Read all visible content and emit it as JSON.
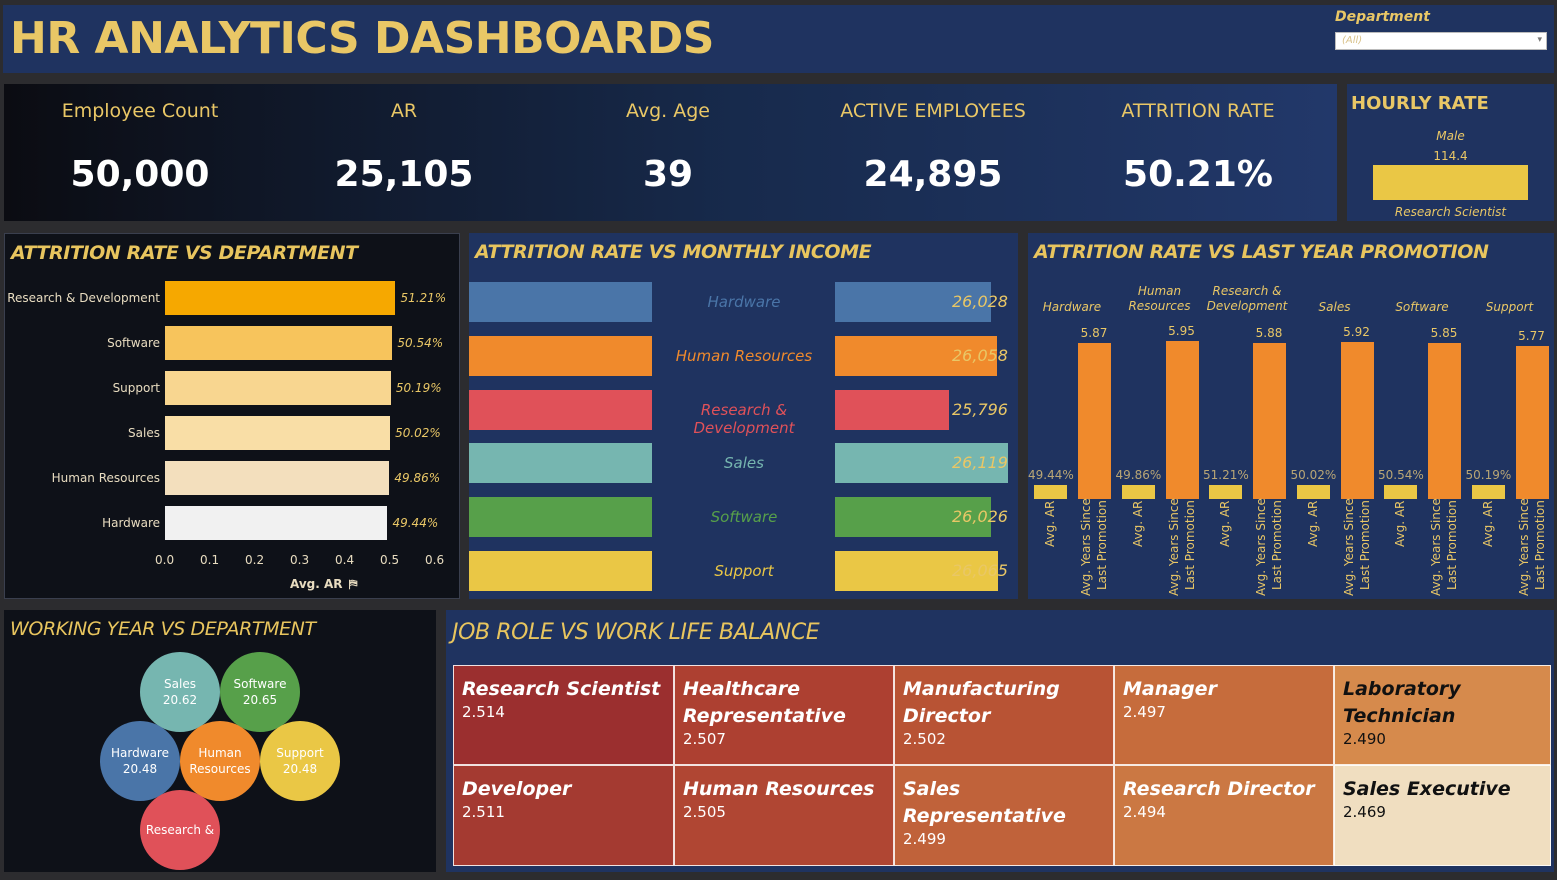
{
  "header": {
    "title": "HR ANALYTICS DASHBOARDS",
    "filter_label": "Department",
    "filter_value": "(All)"
  },
  "kpis": [
    {
      "label": "Employee Count",
      "value": "50,000"
    },
    {
      "label": "AR",
      "value": "25,105"
    },
    {
      "label": "Avg. Age",
      "value": "39"
    },
    {
      "label": "ACTIVE EMPLOYEES",
      "value": "24,895"
    },
    {
      "label": "ATTRITION RATE",
      "value": "50.21%"
    }
  ],
  "hourly_rate": {
    "title": "HOURLY RATE",
    "gender": "Male",
    "value": "114.4",
    "role": "Research Scientist"
  },
  "dept_chart": {
    "title": "ATTRITION RATE VS DEPARTMENT",
    "axis_label": "Avg. AR",
    "chart_data": {
      "type": "bar",
      "orientation": "horizontal",
      "categories": [
        "Research & Development",
        "Software",
        "Support",
        "Sales",
        "Human Resources",
        "Hardware"
      ],
      "values": [
        0.5121,
        0.5054,
        0.5019,
        0.5002,
        0.4986,
        0.4944
      ],
      "value_labels": [
        "51.21%",
        "50.54%",
        "50.19%",
        "50.02%",
        "49.86%",
        "49.44%"
      ],
      "colors": [
        "#f6a800",
        "#f7c45c",
        "#f8d690",
        "#f9dea6",
        "#f3dfbd",
        "#f1f1f1"
      ],
      "xlim": [
        0,
        0.6
      ],
      "ticks": [
        "0.0",
        "0.1",
        "0.2",
        "0.3",
        "0.4",
        "0.5",
        "0.6"
      ],
      "xlabel": "Avg. AR"
    }
  },
  "income_chart": {
    "title": "ATTRITION RATE VS MONTHLY INCOME",
    "chart_data": {
      "type": "bar",
      "categories": [
        "Hardware",
        "Human Resources",
        "Research & Development",
        "Sales",
        "Software",
        "Support"
      ],
      "attrition": [
        0.4944,
        0.4986,
        0.5121,
        0.5002,
        0.5054,
        0.5019
      ],
      "attrition_labels": [
        "49.44%",
        "49.86%",
        "51.21%",
        "50.02%",
        "50.54%",
        "50.19%"
      ],
      "income": [
        26028,
        26058,
        25796,
        26119,
        26026,
        26065
      ],
      "income_labels": [
        "26,028",
        "26,058",
        "25,796",
        "26,119",
        "26,026",
        "26,065"
      ],
      "colors": [
        "#4a75a8",
        "#f08a2c",
        "#e05159",
        "#76b6b0",
        "#57a04a",
        "#eac745"
      ]
    }
  },
  "promotion_chart": {
    "title": "ATTRITION RATE VS LAST YEAR PROMOTION",
    "chart_data": {
      "type": "bar",
      "categories": [
        "Hardware",
        "Human Resources",
        "Research & Development",
        "Sales",
        "Software",
        "Support"
      ],
      "category_labels": [
        [
          "Hardware"
        ],
        [
          "Human",
          "Resources"
        ],
        [
          "Research &",
          "Development"
        ],
        [
          "Sales"
        ],
        [
          "Software"
        ],
        [
          "Support"
        ]
      ],
      "series": [
        {
          "name": "Avg. AR",
          "values": [
            0.4944,
            0.4986,
            0.5121,
            0.5002,
            0.5054,
            0.5019
          ],
          "labels": [
            "49.44%",
            "49.86%",
            "51.21%",
            "50.02%",
            "50.54%",
            "50.19%"
          ]
        },
        {
          "name": "Avg. Years Since Last Promotion",
          "values": [
            5.87,
            5.95,
            5.88,
            5.92,
            5.85,
            5.77
          ],
          "labels": [
            "5.87",
            "5.95",
            "5.88",
            "5.92",
            "5.85",
            "5.77"
          ]
        }
      ],
      "axis_label_1": "Avg. AR",
      "axis_label_2a": "Avg. Years Since",
      "axis_label_2b": "Last Promotion"
    }
  },
  "working_year": {
    "title": "WORKING YEAR VS DEPARTMENT",
    "bubbles": [
      {
        "name": "Sales",
        "value": "20.62",
        "color": "#76b6b0"
      },
      {
        "name": "Software",
        "value": "20.65",
        "color": "#57a04a"
      },
      {
        "name": "Hardware",
        "value": "20.48",
        "color": "#4a75a8"
      },
      {
        "name": "Human",
        "name2": "Resources",
        "value": "",
        "color": "#f08a2c"
      },
      {
        "name": "Support",
        "value": "20.48",
        "color": "#eac745"
      },
      {
        "name": "Research &",
        "value": "",
        "color": "#e05159"
      }
    ]
  },
  "job_role": {
    "title": "JOB ROLE VS WORK LIFE BALANCE",
    "tiles": [
      {
        "lines": [
          "Research Scientist"
        ],
        "value": "2.514",
        "color": "#9b2f2f",
        "text": "#ffffff"
      },
      {
        "lines": [
          "Healthcare",
          "Representative"
        ],
        "value": "2.507",
        "color": "#ad4031",
        "text": "#ffffff"
      },
      {
        "lines": [
          "Manufacturing",
          "Director"
        ],
        "value": "2.502",
        "color": "#b85334",
        "text": "#ffffff"
      },
      {
        "lines": [
          "Manager"
        ],
        "value": "2.497",
        "color": "#c66c3c",
        "text": "#ffffff"
      },
      {
        "lines": [
          "Laboratory",
          "Technician"
        ],
        "value": "2.490",
        "color": "#d68a4c",
        "text": "#111111"
      },
      {
        "lines": [
          "Developer"
        ],
        "value": "2.511",
        "color": "#a43a31",
        "text": "#ffffff"
      },
      {
        "lines": [
          "Human Resources"
        ],
        "value": "2.505",
        "color": "#b04633",
        "text": "#ffffff"
      },
      {
        "lines": [
          "Sales Representative"
        ],
        "value": "2.499",
        "color": "#c0623a",
        "text": "#ffffff"
      },
      {
        "lines": [
          "Research Director"
        ],
        "value": "2.494",
        "color": "#cb7843",
        "text": "#ffffff"
      },
      {
        "lines": [
          "Sales Executive"
        ],
        "value": "2.469",
        "color": "#f0dec0",
        "text": "#111111"
      }
    ]
  }
}
